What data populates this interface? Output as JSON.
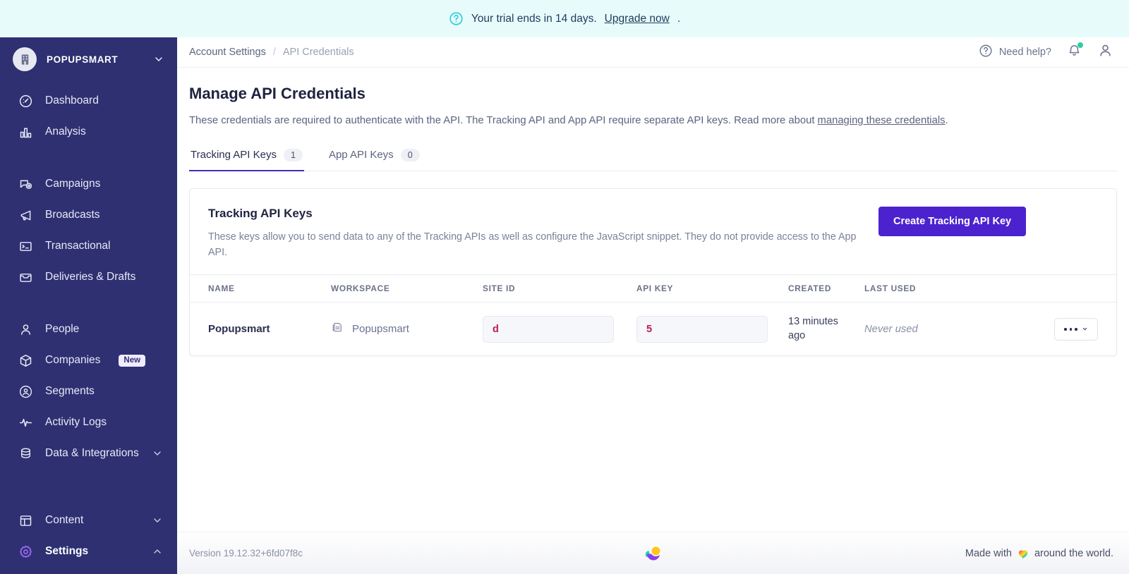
{
  "banner": {
    "icon": "question-circle-icon",
    "text": "Your trial ends in 14 days.",
    "link": "Upgrade now",
    "suffix": ".",
    "bg": "#e7fbfb"
  },
  "sidebar": {
    "workspace": {
      "name": "POPUPSMART",
      "avatar_icon": "building-icon",
      "chevron": "chevron-down-icon"
    },
    "bg": "#2e3072",
    "groups": [
      {
        "items": [
          {
            "label": "Dashboard",
            "icon": "dashboard-gauge-icon"
          },
          {
            "label": "Analysis",
            "icon": "bar-chart-icon"
          }
        ]
      },
      {
        "items": [
          {
            "label": "Campaigns",
            "icon": "campaign-bubble-icon"
          },
          {
            "label": "Broadcasts",
            "icon": "megaphone-icon"
          },
          {
            "label": "Transactional",
            "icon": "terminal-icon"
          },
          {
            "label": "Deliveries & Drafts",
            "icon": "inbox-icon"
          }
        ]
      },
      {
        "items": [
          {
            "label": "People",
            "icon": "person-icon"
          },
          {
            "label": "Companies",
            "icon": "box-icon",
            "badge": "New"
          },
          {
            "label": "Segments",
            "icon": "segment-user-circle-icon"
          },
          {
            "label": "Activity Logs",
            "icon": "pulse-icon"
          },
          {
            "label": "Data & Integrations",
            "icon": "database-icon",
            "chevron": "chevron-down-icon"
          }
        ]
      }
    ],
    "bottom": [
      {
        "label": "Content",
        "icon": "layout-icon",
        "chevron": "chevron-down-icon",
        "active": false
      },
      {
        "label": "Settings",
        "icon": "gear-icon",
        "chevron": "chevron-up-icon",
        "active": true
      }
    ],
    "active_accent": "#9b6bf2"
  },
  "topbar": {
    "breadcrumb": {
      "parent": "Account Settings",
      "separator": "/",
      "current": "API Credentials"
    },
    "need_help": "Need help?",
    "help_icon": "question-circle-icon",
    "bell_icon": "bell-icon",
    "bell_dot_color": "#2bcf9e",
    "avatar_icon": "user-icon"
  },
  "page": {
    "title": "Manage API Credentials",
    "description_before": "These credentials are required to authenticate with the API. The Tracking API and App API require separate API keys. Read more about ",
    "description_link": "managing these credentials",
    "description_after": "."
  },
  "tabs": [
    {
      "label": "Tracking API Keys",
      "count": "1",
      "active": true
    },
    {
      "label": "App API Keys",
      "count": "0",
      "active": false
    }
  ],
  "card": {
    "title": "Tracking API Keys",
    "subtitle": "These keys allow you to send data to any of the Tracking APIs as well as configure the JavaScript snippet. They do not provide access to the App API.",
    "create_button": "Create Tracking API Key",
    "create_button_color": "#4c22cf",
    "columns": [
      "NAME",
      "WORKSPACE",
      "SITE ID",
      "API KEY",
      "CREATED",
      "LAST USED",
      ""
    ],
    "rows": [
      {
        "name": "Popupsmart",
        "workspace": "Popupsmart",
        "workspace_icon": "copy-documents-icon",
        "site_id": "d",
        "api_key": "5",
        "created": "13 minutes ago",
        "last_used": "Never used",
        "actions_icon": "ellipsis-icon",
        "actions_chevron": "chevron-down-icon"
      }
    ],
    "value_color": "#b51e54"
  },
  "footer": {
    "version": "Version 19.12.32+6fd07f8c",
    "logo_icon": "customerio-logo-icon",
    "made_before": "Made with",
    "made_heart": "rainbow-heart-icon",
    "made_after": "around the world."
  }
}
